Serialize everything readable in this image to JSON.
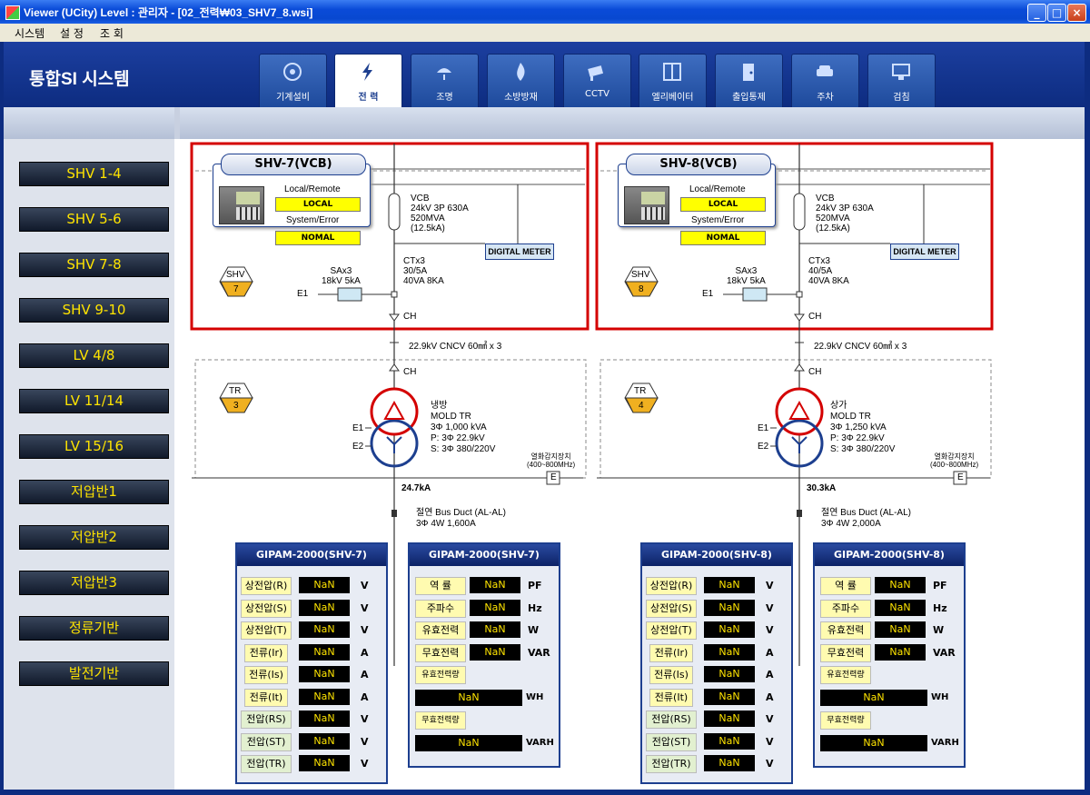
{
  "window": {
    "title": "Viewer (UCity) Level : 관리자 - [02_전력₩03_SHV7_8.wsi]"
  },
  "menu": [
    "시스템",
    "설 정",
    "조 회"
  ],
  "header": {
    "title": "통합SI 시스템"
  },
  "tabs": [
    {
      "label": "기계설비",
      "icon": "fan-icon"
    },
    {
      "label": "전 력",
      "icon": "lightning-icon",
      "active": true
    },
    {
      "label": "조명",
      "icon": "lamp-icon"
    },
    {
      "label": "소방방재",
      "icon": "flame-icon"
    },
    {
      "label": "CCTV",
      "icon": "camera-icon"
    },
    {
      "label": "엘리베이터",
      "icon": "elevator-icon"
    },
    {
      "label": "출입통제",
      "icon": "door-icon"
    },
    {
      "label": "주차",
      "icon": "car-icon"
    },
    {
      "label": "검침",
      "icon": "monitor-icon"
    }
  ],
  "nav": [
    "SHV 1-4",
    "SHV 5-6",
    "SHV 7-8",
    "SHV 9-10",
    "LV 4/8",
    "LV 11/14",
    "LV 15/16",
    "저압반1",
    "저압반2",
    "저압반3",
    "정류기반",
    "발전기반"
  ],
  "shv": [
    {
      "panel_title": "SHV-7(VCB)",
      "local_remote_label": "Local/Remote",
      "local_remote_value": "LOCAL",
      "system_error_label": "System/Error",
      "system_error_value": "NOMAL",
      "shv_badge": {
        "top": "SHV",
        "num": "7"
      },
      "vcb": [
        "VCB",
        "24kV 3P 630A",
        "520MVA",
        "(12.5kA)"
      ],
      "ct": [
        "CTx3",
        "30/5A",
        "40VA 8KA"
      ],
      "sa": [
        "SAx3",
        "18kV 5kA"
      ],
      "e1": "E1",
      "ch": "CH",
      "digital_meter": "DIGITAL METER",
      "cable": "22.9kV CNCV 60㎟ x 3",
      "tr_badge": {
        "top": "TR",
        "num": "3"
      },
      "tr_ch": "CH",
      "tr": [
        "냉방",
        "MOLD TR",
        "3Φ  1,000 kVA",
        "P: 3Φ 22.9kV",
        "S: 3Φ 380/220V"
      ],
      "tr_e1": "E1",
      "tr_e2": "E2",
      "detector": [
        "열화감지장치",
        "(400~800MHz)"
      ],
      "e_box": "E",
      "fault": "24.7kA",
      "busduct": [
        "절연 Bus Duct (AL-AL)",
        "3Φ 4W 1,600A"
      ]
    },
    {
      "panel_title": "SHV-8(VCB)",
      "local_remote_label": "Local/Remote",
      "local_remote_value": "LOCAL",
      "system_error_label": "System/Error",
      "system_error_value": "NOMAL",
      "shv_badge": {
        "top": "SHV",
        "num": "8"
      },
      "vcb": [
        "VCB",
        "24kV 3P 630A",
        "520MVA",
        "(12.5kA)"
      ],
      "ct": [
        "CTx3",
        "40/5A",
        "40VA 8KA"
      ],
      "sa": [
        "SAx3",
        "18kV 5kA"
      ],
      "e1": "E1",
      "ch": "CH",
      "digital_meter": "DIGITAL METER",
      "cable": "22.9kV CNCV 60㎟ x 3",
      "tr_badge": {
        "top": "TR",
        "num": "4"
      },
      "tr_ch": "CH",
      "tr": [
        "상가",
        "MOLD TR",
        "3Φ  1,250 kVA",
        "P: 3Φ 22.9kV",
        "S: 3Φ 380/220V"
      ],
      "tr_e1": "E1",
      "tr_e2": "E2",
      "detector": [
        "열화감지장치",
        "(400~800MHz)"
      ],
      "e_box": "E",
      "fault": "30.3kA",
      "busduct": [
        "절연 Bus Duct (AL-AL)",
        "3Φ 4W 2,000A"
      ]
    }
  ],
  "gipam": [
    {
      "title": "GIPAM-2000(SHV-7)",
      "rows": [
        {
          "label": "상전압(R)",
          "value": "NaN",
          "unit": "V"
        },
        {
          "label": "상전압(S)",
          "value": "NaN",
          "unit": "V"
        },
        {
          "label": "상전압(T)",
          "value": "NaN",
          "unit": "V"
        },
        {
          "label": "전류(Ir)",
          "value": "NaN",
          "unit": "A"
        },
        {
          "label": "전류(Is)",
          "value": "NaN",
          "unit": "A"
        },
        {
          "label": "전류(It)",
          "value": "NaN",
          "unit": "A"
        },
        {
          "label": "전압(RS)",
          "value": "NaN",
          "unit": "V"
        },
        {
          "label": "전압(ST)",
          "value": "NaN",
          "unit": "V"
        },
        {
          "label": "전압(TR)",
          "value": "NaN",
          "unit": "V"
        }
      ]
    },
    {
      "title": "GIPAM-2000(SHV-7)",
      "rows": [
        {
          "label": "역 률",
          "value": "NaN",
          "unit": "PF"
        },
        {
          "label": "주파수",
          "value": "NaN",
          "unit": "Hz"
        },
        {
          "label": "유효전력",
          "value": "NaN",
          "unit": "W"
        },
        {
          "label": "무효전력",
          "value": "NaN",
          "unit": "VAR"
        }
      ],
      "energy": [
        {
          "label": "유효전력량",
          "value": "NaN",
          "unit": "WH"
        },
        {
          "label": "무효전력량",
          "value": "NaN",
          "unit": "VARH"
        }
      ]
    },
    {
      "title": "GIPAM-2000(SHV-8)",
      "rows": [
        {
          "label": "상전압(R)",
          "value": "NaN",
          "unit": "V"
        },
        {
          "label": "상전압(S)",
          "value": "NaN",
          "unit": "V"
        },
        {
          "label": "상전압(T)",
          "value": "NaN",
          "unit": "V"
        },
        {
          "label": "전류(Ir)",
          "value": "NaN",
          "unit": "A"
        },
        {
          "label": "전류(Is)",
          "value": "NaN",
          "unit": "A"
        },
        {
          "label": "전류(It)",
          "value": "NaN",
          "unit": "A"
        },
        {
          "label": "전압(RS)",
          "value": "NaN",
          "unit": "V"
        },
        {
          "label": "전압(ST)",
          "value": "NaN",
          "unit": "V"
        },
        {
          "label": "전압(TR)",
          "value": "NaN",
          "unit": "V"
        }
      ]
    },
    {
      "title": "GIPAM-2000(SHV-8)",
      "rows": [
        {
          "label": "역 률",
          "value": "NaN",
          "unit": "PF"
        },
        {
          "label": "주파수",
          "value": "NaN",
          "unit": "Hz"
        },
        {
          "label": "유효전력",
          "value": "NaN",
          "unit": "W"
        },
        {
          "label": "무효전력",
          "value": "NaN",
          "unit": "VAR"
        }
      ],
      "energy": [
        {
          "label": "유효전력량",
          "value": "NaN",
          "unit": "WH"
        },
        {
          "label": "무효전력량",
          "value": "NaN",
          "unit": "VARH"
        }
      ]
    }
  ],
  "colors": {
    "accent_red": "#d40000",
    "brand_blue": "#1d3f8f",
    "value_yellow": "#ffe400",
    "status_yellow": "#ffff00"
  }
}
